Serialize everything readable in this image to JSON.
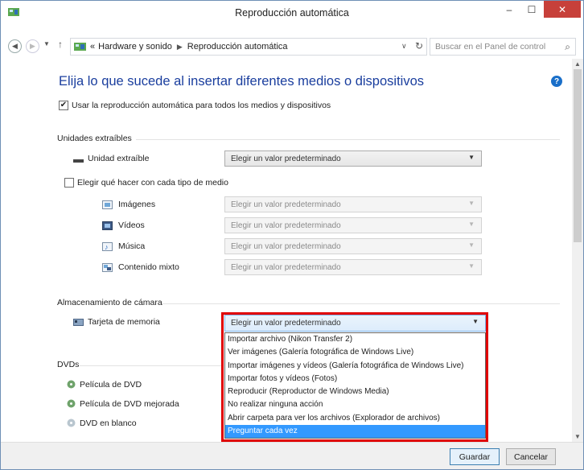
{
  "window": {
    "title": "Reproducción automática",
    "minimize_label": "–",
    "maximize_label": "☐",
    "close_label": "✕"
  },
  "address": {
    "crumb_prefix": "«",
    "crumbs": [
      "Hardware y sonido",
      "Reproducción automática"
    ],
    "search_placeholder": "Buscar en el Panel de control"
  },
  "main": {
    "heading": "Elija lo que sucede al insertar diferentes medios o dispositivos",
    "use_autoplay_label": "Usar la reproducción automática para todos los medios y dispositivos",
    "use_autoplay_checked": true
  },
  "removable": {
    "group_title": "Unidades extraíbles",
    "drive_label": "Unidad extraíble",
    "drive_value": "Elegir un valor predeterminado",
    "per_media_label": "Elegir qué hacer con cada tipo de medio",
    "per_media_checked": false,
    "media": [
      {
        "label": "Imágenes",
        "value": "Elegir un valor predeterminado"
      },
      {
        "label": "Vídeos",
        "value": "Elegir un valor predeterminado"
      },
      {
        "label": "Música",
        "value": "Elegir un valor predeterminado"
      },
      {
        "label": "Contenido mixto",
        "value": "Elegir un valor predeterminado"
      }
    ]
  },
  "camera": {
    "group_title": "Almacenamiento de cámara",
    "memory_card_label": "Tarjeta de memoria",
    "memory_card_value": "Elegir un valor predeterminado",
    "options": [
      "Importar archivo (Nikon Transfer 2)",
      "Ver imágenes (Galería fotográfica de Windows Live)",
      "Importar imágenes y vídeos (Galería fotográfica de Windows Live)",
      "Importar fotos y vídeos (Fotos)",
      "Reproducir (Reproductor de Windows Media)",
      "No realizar ninguna acción",
      "Abrir carpeta para ver los archivos (Explorador de archivos)",
      "Preguntar cada vez"
    ],
    "selected_option": "Preguntar cada vez"
  },
  "dvds": {
    "group_title": "DVDs",
    "items": [
      "Película de DVD",
      "Película de DVD mejorada",
      "DVD en blanco"
    ]
  },
  "footer": {
    "save_label": "Guardar",
    "cancel_label": "Cancelar"
  }
}
